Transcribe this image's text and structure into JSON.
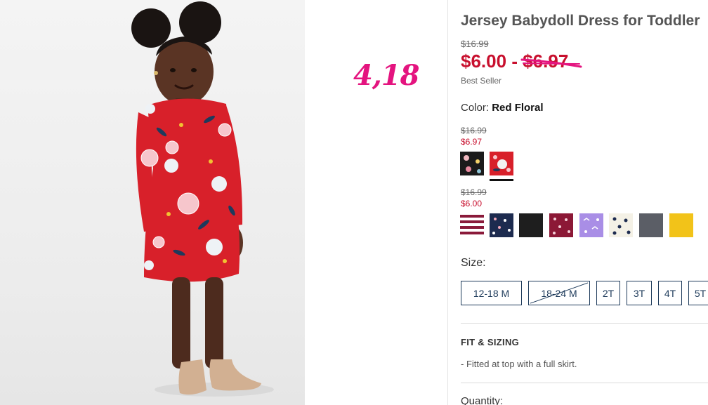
{
  "product": {
    "title": "Jersey Babydoll Dress for Toddler",
    "original_price": "$16.99",
    "sale_price_low": "$6.00",
    "price_separator": "-",
    "sale_price_high": "$6.97",
    "badge": "Best Seller",
    "color_label": "Color:",
    "color_value": "Red Floral"
  },
  "annotation": {
    "text": "4,18",
    "color": "#e4147f"
  },
  "swatch_groups": [
    {
      "original_price": "$16.99",
      "sale_price": "$6.97",
      "swatches": [
        {
          "name": "black-floral",
          "color": "#1b1b1b",
          "selected": false
        },
        {
          "name": "red-floral",
          "color": "#d8202a",
          "selected": true
        }
      ]
    },
    {
      "original_price": "$16.99",
      "sale_price": "$6.00",
      "swatches": [
        {
          "name": "burgundy-white-stripe",
          "color": "#8a1a3a",
          "selected": false
        },
        {
          "name": "navy-floral",
          "color": "#1d2b4f",
          "selected": false
        },
        {
          "name": "black",
          "color": "#1e1e1e",
          "selected": false
        },
        {
          "name": "burgundy-dot",
          "color": "#8c1836",
          "selected": false
        },
        {
          "name": "lavender-print",
          "color": "#a98ee6",
          "selected": false
        },
        {
          "name": "cream-navy-dot",
          "color": "#f4f1e6",
          "selected": false
        },
        {
          "name": "charcoal",
          "color": "#5b5e66",
          "selected": false
        },
        {
          "name": "yellow",
          "color": "#f2c319",
          "selected": false
        }
      ]
    }
  ],
  "size": {
    "label": "Size:",
    "options": [
      {
        "label": "12-18 M",
        "available": true
      },
      {
        "label": "18-24 M",
        "available": false
      },
      {
        "label": "2T",
        "available": true
      },
      {
        "label": "3T",
        "available": true
      },
      {
        "label": "4T",
        "available": true
      },
      {
        "label": "5T",
        "available": true
      }
    ]
  },
  "fit": {
    "heading": "FIT & SIZING",
    "bullet": "-",
    "item": "Fitted at top with a full skirt."
  },
  "quantity": {
    "label": "Quantity:"
  },
  "colors": {
    "sale_red": "#c8102e",
    "navy_border": "#1d3a5a",
    "annotation_pink": "#e4147f"
  }
}
